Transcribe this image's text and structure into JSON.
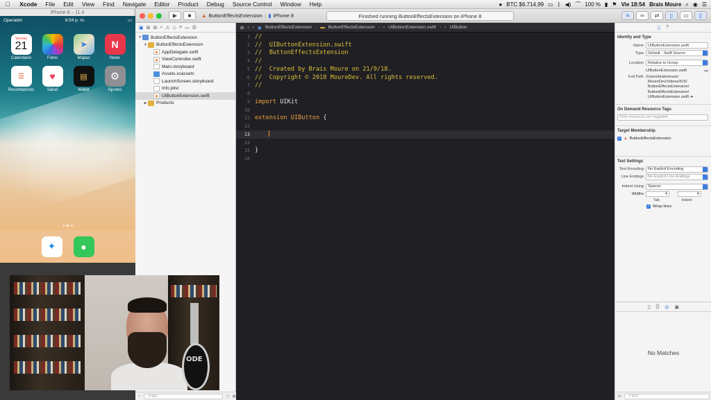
{
  "menubar": {
    "apple_icon": "apple-icon",
    "items": [
      "Xcode",
      "File",
      "Edit",
      "View",
      "Find",
      "Navigate",
      "Editor",
      "Product",
      "Debug",
      "Source Control",
      "Window",
      "Help"
    ],
    "right": {
      "btc": "BTC $6.714,99",
      "battery": "100 %",
      "clock": "Vie 18:54",
      "user": "Brais Moure"
    }
  },
  "simulator": {
    "title": "iPhone 8 – 11.4",
    "carrier": "Operador",
    "time": "6:54 p. m.",
    "calendar_day": "Viernes",
    "calendar_date": "21",
    "apps": [
      "Calendario",
      "Fotos",
      "Mapas",
      "News",
      "Recordatorios",
      "Salud",
      "Wallet",
      "Ajustes"
    ],
    "dock": [
      "Safari",
      "Mensajes"
    ]
  },
  "xcode": {
    "scheme_target": "ButtonEffectsExtension",
    "scheme_device": "iPhone 8",
    "activity": "Finished running ButtonEffectsExtension on iPhone 8",
    "navigator": {
      "filter_placeholder": "Filter",
      "items": [
        {
          "label": "ButtonEffectsExtension",
          "level": 0,
          "kind": "proj",
          "open": true
        },
        {
          "label": "ButtonEffectsExtension",
          "level": 1,
          "kind": "fold",
          "open": true
        },
        {
          "label": "AppDelegate.swift",
          "level": 2,
          "kind": "swift"
        },
        {
          "label": "ViewController.swift",
          "level": 2,
          "kind": "swift"
        },
        {
          "label": "Main.storyboard",
          "level": 2,
          "kind": "sb"
        },
        {
          "label": "Assets.xcassets",
          "level": 2,
          "kind": "as"
        },
        {
          "label": "LaunchScreen.storyboard",
          "level": 2,
          "kind": "sb"
        },
        {
          "label": "Info.plist",
          "level": 2,
          "kind": "pl"
        },
        {
          "label": "UIButtonExtension.swift",
          "level": 2,
          "kind": "swift",
          "selected": true
        },
        {
          "label": "Products",
          "level": 1,
          "kind": "fold",
          "open": false
        }
      ]
    },
    "jumpbar": [
      "ButtonEffectsExtension",
      "ButtonEffectsExtension",
      "UIButtonExtension.swift",
      "UIButton"
    ],
    "code": [
      {
        "n": "1",
        "t": "//",
        "c": "com"
      },
      {
        "n": "2",
        "t": "//  UIButtonExtension.swift",
        "c": "com"
      },
      {
        "n": "3",
        "t": "//  ButtonEffectsExtension",
        "c": "com"
      },
      {
        "n": "4",
        "t": "//",
        "c": "com"
      },
      {
        "n": "5",
        "t": "//  Created by Brais Moure on 21/9/18.",
        "c": "com"
      },
      {
        "n": "6",
        "t": "//  Copyright © 2018 MoureDev. All rights reserved.",
        "c": "com"
      },
      {
        "n": "7",
        "t": "//",
        "c": "com"
      },
      {
        "n": "8",
        "t": "",
        "c": ""
      },
      {
        "n": "9",
        "t": "import UIKit",
        "c": "import"
      },
      {
        "n": "10",
        "t": "",
        "c": ""
      },
      {
        "n": "11",
        "t": "extension UIButton {",
        "c": "ext"
      },
      {
        "n": "12",
        "t": "",
        "c": ""
      },
      {
        "n": "13",
        "t": "",
        "c": "cursor"
      },
      {
        "n": "14",
        "t": "",
        "c": ""
      },
      {
        "n": "15",
        "t": "}",
        "c": ""
      },
      {
        "n": "16",
        "t": "",
        "c": ""
      }
    ],
    "inspector": {
      "identity_title": "Identity and Type",
      "name_label": "Name",
      "name_value": "UIButtonExtension.swift",
      "type_label": "Type",
      "type_value": "Default - Swift Source",
      "location_label": "Location",
      "location_value": "Relative to Group",
      "location_file": "UIButtonExtension.swift",
      "fullpath_label": "Full Path",
      "fullpath_lines": [
        "/Users/braismoure/",
        "MoureDev/Videos/iOS/",
        "ButtonEffectsExtension/",
        "ButtonEffectsExtension/",
        "UIButtonExtension.swift"
      ],
      "odr_title": "On Demand Resource Tags",
      "odr_placeholder": "Only resources are taggable",
      "membership_title": "Target Membership",
      "membership_target": "ButtonEffectsExtension",
      "text_title": "Text Settings",
      "encoding_label": "Text Encoding",
      "encoding_value": "No Explicit Encoding",
      "endings_label": "Line Endings",
      "endings_value": "No Explicit Line Endings",
      "indent_label": "Indent Using",
      "indent_value": "Spaces",
      "widths_label": "Widths",
      "tab_value": "4",
      "indent_value_num": "4",
      "tab_sub": "Tab",
      "indent_sub": "Indent",
      "wrap_label": "Wrap lines",
      "library_empty": "No Matches",
      "library_filter": "Filter"
    }
  }
}
